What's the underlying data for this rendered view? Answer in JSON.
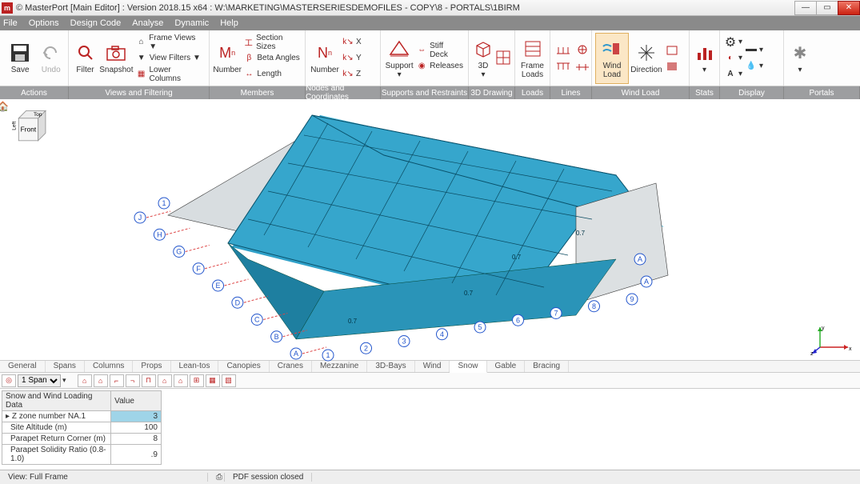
{
  "window": {
    "title": "© MasterPort [Main Editor] : Version 2018.15 x64 : W:\\MARKETING\\MASTERSERIESDEMOFILES - COPY\\8 - PORTALS\\1BIRM"
  },
  "menu": [
    "File",
    "Options",
    "Design Code",
    "Analyse",
    "Dynamic",
    "Help"
  ],
  "ribbon": {
    "save": "Save",
    "undo": "Undo",
    "filter": "Filter",
    "snapshot": "Snapshot",
    "frameviews": "Frame Views ▼",
    "viewfilters": "View Filters ▼",
    "lowercolumns": "Lower Columns",
    "number_m": "Number",
    "sectionsizes": "Section Sizes",
    "betaangles": "Beta Angles",
    "length": "Length",
    "number_n": "Number",
    "kx": "X",
    "ky": "Y",
    "kz": "Z",
    "support": "Support",
    "stiffdeck": "Stiff Deck",
    "releases": "Releases",
    "threeD": "3D",
    "frameloads": "Frame\nLoads",
    "loads": "Loads",
    "windload": "Wind\nLoad",
    "direction": "Direction"
  },
  "ribbon_groups": {
    "actions": "Actions",
    "viewsfiltering": "Views and Filtering",
    "members": "Members",
    "nodescoord": "Nodes and Coordinates",
    "supports": "Supports and Restraints",
    "drawing3d": "3D Drawing",
    "loads": "Loads",
    "lines": "Lines",
    "windload": "Wind Load",
    "stats": "Stats",
    "display": "Display",
    "portals": "Portals"
  },
  "cube": {
    "front": "Front",
    "left": "Left",
    "top": "Top"
  },
  "grid_letters": [
    "A",
    "B",
    "C",
    "D",
    "E",
    "F",
    "G",
    "H",
    "J"
  ],
  "grid_numbers": [
    "1",
    "2",
    "3",
    "4",
    "5",
    "6",
    "7",
    "8",
    "9"
  ],
  "grid_right": [
    "A",
    "A"
  ],
  "loadval": "0.7",
  "tabs": [
    "General",
    "Spans",
    "Columns",
    "Props",
    "Lean-tos",
    "Canopies",
    "Cranes",
    "Mezzanine",
    "3D-Bays",
    "Wind",
    "Snow",
    "Gable",
    "Bracing"
  ],
  "active_tab": "Snow",
  "span_sel": "1 Span",
  "prop": {
    "header_name": "Snow and Wind Loading Data",
    "header_val": "Value",
    "r1n": "Z zone number NA.1",
    "r1v": "3",
    "r2n": "Site Altitude (m)",
    "r2v": "100",
    "r3n": "Parapet Return Corner (m)",
    "r3v": "8",
    "r4n": "Parapet Solidity Ratio (0.8-1.0)",
    "r4v": ".9"
  },
  "status": {
    "view": "View: Full Frame",
    "pdf": "PDF session closed"
  },
  "axes": {
    "x": "x",
    "y": "y",
    "z": "z"
  }
}
